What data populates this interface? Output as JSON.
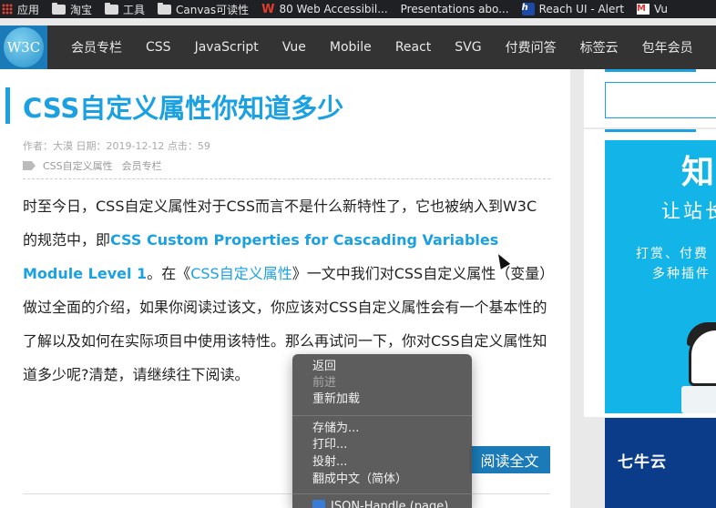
{
  "bookmarks": [
    {
      "icon": "apps-icon",
      "label": "应用"
    },
    {
      "icon": "folder-icon",
      "label": "淘宝"
    },
    {
      "icon": "folder-icon",
      "label": "工具"
    },
    {
      "icon": "folder-icon",
      "label": "Canvas可读性"
    },
    {
      "icon": "w-logo-icon",
      "label": "80 Web Accessibil..."
    },
    {
      "icon": "",
      "label": "Presentations abo..."
    },
    {
      "icon": "h-logo-icon",
      "label": "Reach UI - Alert"
    },
    {
      "icon": "gmail-icon",
      "label": "Vu"
    }
  ],
  "nav": {
    "logo_text": "W3C",
    "items": [
      "会员专栏",
      "CSS",
      "JavaScript",
      "Vue",
      "Mobile",
      "React",
      "SVG",
      "付费问答",
      "标签云",
      "包年会员"
    ]
  },
  "article": {
    "title": "CSS自定义属性你知道多少",
    "meta": "作者：大漠 日期：2019-12-12 点击：59",
    "tags": [
      "CSS自定义属性",
      "会员专栏"
    ],
    "body": {
      "p1": "时至今日，CSS自定义属性对于CSS而言不是什么新特性了，它也被纳入到W3C的规范中，即",
      "strong_link": "CSS Custom Properties for Cascading Variables Module Level 1",
      "p2": "。在《",
      "link": "CSS自定义属性",
      "p3": "》一文中我们对CSS自定义属性（变量）做过全面的介绍，如果你阅读过该文，你应该对CSS自定义属性会有一个基本性的了解以及如何在实际项目中使用该特性。那么再试问一下，你对CSS自定义属性知道多少呢?",
      "p3_tail": "清楚，请继续往下阅读。"
    },
    "read_more": "阅读全文"
  },
  "sidebar": {
    "ad1": {
      "big": "知",
      "line1": "让站长",
      "line2": "打赏、付费",
      "line3": "多种插件"
    },
    "ad2": {
      "logo": "七牛云"
    }
  },
  "context_menu": {
    "items": [
      {
        "label": "返回",
        "disabled": false
      },
      {
        "label": "前进",
        "disabled": true
      },
      {
        "label": "重新加载",
        "disabled": false
      },
      {
        "label": "存储为...",
        "disabled": false
      },
      {
        "label": "打印...",
        "disabled": false
      },
      {
        "label": "投射...",
        "disabled": false
      },
      {
        "label": "翻成中文（简体）",
        "disabled": false
      },
      {
        "label": "JSON-Handle (page)",
        "disabled": false
      }
    ]
  },
  "colors": {
    "accent": "#1ba1e2",
    "nav_bg": "#333333",
    "bookmarks_bg": "#1f2023",
    "menu_bg": "#565656"
  }
}
